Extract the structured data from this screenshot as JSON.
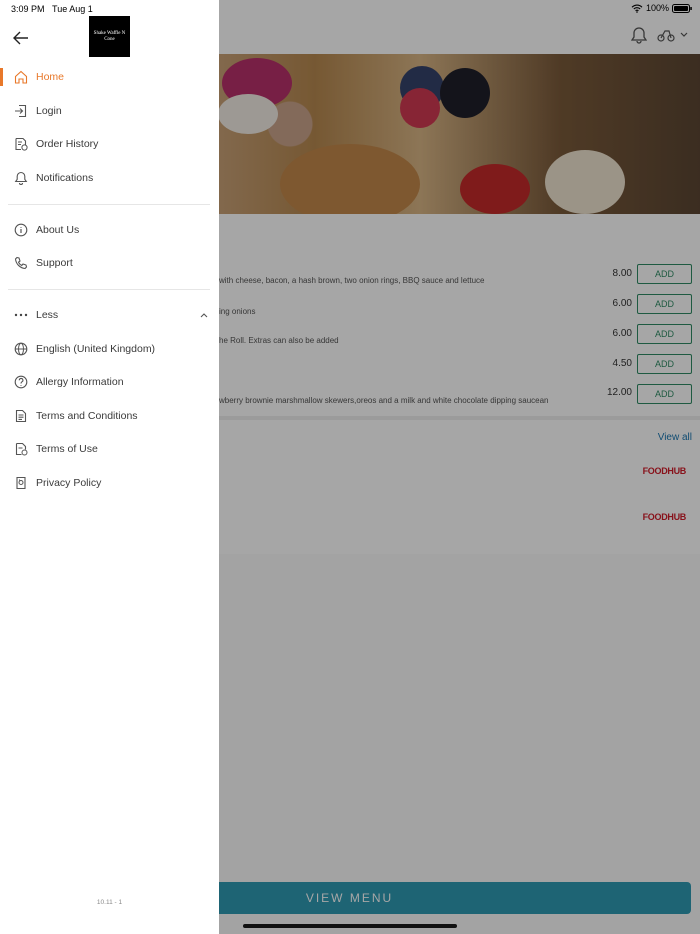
{
  "status_bar": {
    "time": "3:09 PM",
    "date": "Tue Aug 1",
    "battery": "100%"
  },
  "drawer": {
    "logo_text": "Shake Waffle N Cone",
    "primary_items": [
      {
        "label": "Home",
        "icon": "home-icon",
        "active": true
      },
      {
        "label": "Login",
        "icon": "login-icon"
      },
      {
        "label": "Order History",
        "icon": "order-history-icon"
      },
      {
        "label": "Notifications",
        "icon": "bell-icon"
      }
    ],
    "secondary_items": [
      {
        "label": "About Us",
        "icon": "info-icon"
      },
      {
        "label": "Support",
        "icon": "phone-icon"
      }
    ],
    "more_toggle": {
      "label": "Less",
      "icon": "ellipsis-icon",
      "chevron": "chevron-up-icon"
    },
    "more_items": [
      {
        "label": "English (United Kingdom)",
        "icon": "globe-icon"
      },
      {
        "label": "Allergy Information",
        "icon": "question-icon"
      },
      {
        "label": "Terms and Conditions",
        "icon": "document-icon"
      },
      {
        "label": "Terms of Use",
        "icon": "document-check-icon"
      },
      {
        "label": "Privacy Policy",
        "icon": "privacy-icon"
      }
    ],
    "version": "10.11 - 1"
  },
  "background": {
    "menu_items": [
      {
        "description": "with cheese, bacon, a hash brown, two onion rings, BBQ sauce and lettuce",
        "price": "8.00",
        "add_label": "ADD"
      },
      {
        "description": "ing onions",
        "price": "6.00",
        "add_label": "ADD"
      },
      {
        "description": "he Roll. Extras can also be added",
        "price": "6.00",
        "add_label": "ADD"
      },
      {
        "description": "",
        "price": "4.50",
        "add_label": "ADD"
      },
      {
        "description": "wberry brownie marshmallow skewers,oreos and a milk and white chocolate dipping saucean",
        "price": "12.00",
        "add_label": "ADD"
      }
    ],
    "view_all": "View all",
    "foodhub_logos": [
      "FOODHUB",
      "FOODHUB"
    ],
    "view_menu_label": "VIEW MENU"
  },
  "colors": {
    "accent": "#e8782a",
    "add_green": "#2f8b64",
    "view_menu": "#2e9ab3",
    "foodhub_red": "#d11c2a"
  }
}
